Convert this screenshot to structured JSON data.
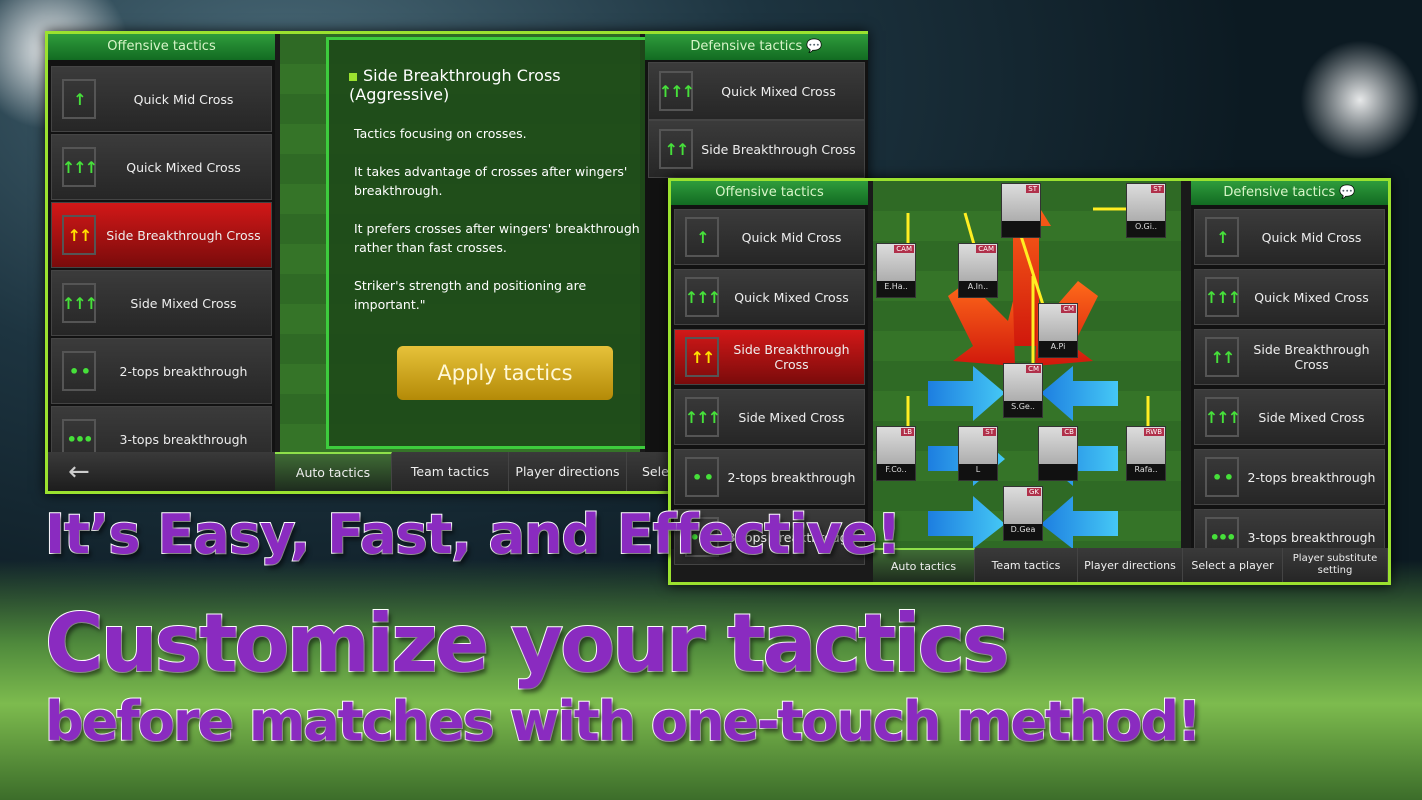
{
  "colors": {
    "accent": "#9be22f",
    "selected": "#d21818",
    "headline": "#8a2bc0",
    "apply": "#d4a81c"
  },
  "panel1": {
    "offensive_header": "Offensive tactics",
    "defensive_header": "Defensive tactics",
    "offensive_items": [
      {
        "label": "Quick Mid Cross",
        "icon": "↑"
      },
      {
        "label": "Quick Mixed Cross",
        "icon": "↑↑↑"
      },
      {
        "label": "Side Breakthrough Cross",
        "icon": "↑↑",
        "selected": true
      },
      {
        "label": "Side Mixed Cross",
        "icon": "↑↑↑"
      },
      {
        "label": "2-tops breakthrough",
        "icon": "• •"
      },
      {
        "label": "3-tops breakthrough",
        "icon": "•••"
      }
    ],
    "defensive_items": [
      {
        "label": "Quick Mixed Cross",
        "icon": "↑↑↑"
      },
      {
        "label": "Side Breakthrough Cross",
        "icon": "↑↑"
      }
    ],
    "description": {
      "title": "Side Breakthrough Cross (Aggressive)",
      "lines": [
        "Tactics focusing on crosses.",
        "It takes advantage of crosses after wingers' breakthrough.",
        "It prefers crosses after wingers' breakthrough rather than fast crosses.",
        "Striker's strength and positioning are important.\""
      ],
      "apply_label": "Apply tactics"
    },
    "tabs": [
      "Auto tactics",
      "Team tactics",
      "Player directions",
      "Sele"
    ],
    "back_icon": "←"
  },
  "panel2": {
    "offensive_header": "Offensive tactics",
    "defensive_header": "Defensive tactics",
    "offensive_items": [
      {
        "label": "Quick Mid Cross",
        "icon": "↑"
      },
      {
        "label": "Quick Mixed Cross",
        "icon": "↑↑↑"
      },
      {
        "label": "Side Breakthrough Cross",
        "icon": "↑↑",
        "selected": true
      },
      {
        "label": "Side Mixed Cross",
        "icon": "↑↑↑"
      },
      {
        "label": "2-tops breakthrough",
        "icon": "• •"
      },
      {
        "label": "3-tops breakthrough",
        "icon": "•••"
      }
    ],
    "defensive_items": [
      {
        "label": "Quick Mid Cross",
        "icon": "↑"
      },
      {
        "label": "Quick Mixed Cross",
        "icon": "↑↑↑"
      },
      {
        "label": "Side Breakthrough Cross",
        "icon": "↑↑"
      },
      {
        "label": "Side Mixed Cross",
        "icon": "↑↑↑"
      },
      {
        "label": "2-tops breakthrough",
        "icon": "• •"
      },
      {
        "label": "3-tops breakthrough",
        "icon": "•••"
      }
    ],
    "players": [
      {
        "pos": "ST",
        "name": ""
      },
      {
        "pos": "ST",
        "name": "O.Gi.."
      },
      {
        "pos": "CAM",
        "name": "E.Ha.."
      },
      {
        "pos": "CAM",
        "name": "A.In.."
      },
      {
        "pos": "CM",
        "name": "A.Pi"
      },
      {
        "pos": "CM",
        "name": "S.Ge.."
      },
      {
        "pos": "LB",
        "name": "F.Co.."
      },
      {
        "pos": "ST",
        "name": "L"
      },
      {
        "pos": "CB",
        "name": ""
      },
      {
        "pos": "RWB",
        "name": "Rafa.."
      },
      {
        "pos": "GK",
        "name": "D.Gea"
      }
    ],
    "tabs": [
      "Auto tactics",
      "Team tactics",
      "Player directions",
      "Select a player",
      "Player substitute setting"
    ]
  },
  "headline": {
    "line1": "It’s Easy, Fast, and Effective!",
    "line2": "Customize your tactics",
    "line3": "before matches with one-touch method!"
  }
}
